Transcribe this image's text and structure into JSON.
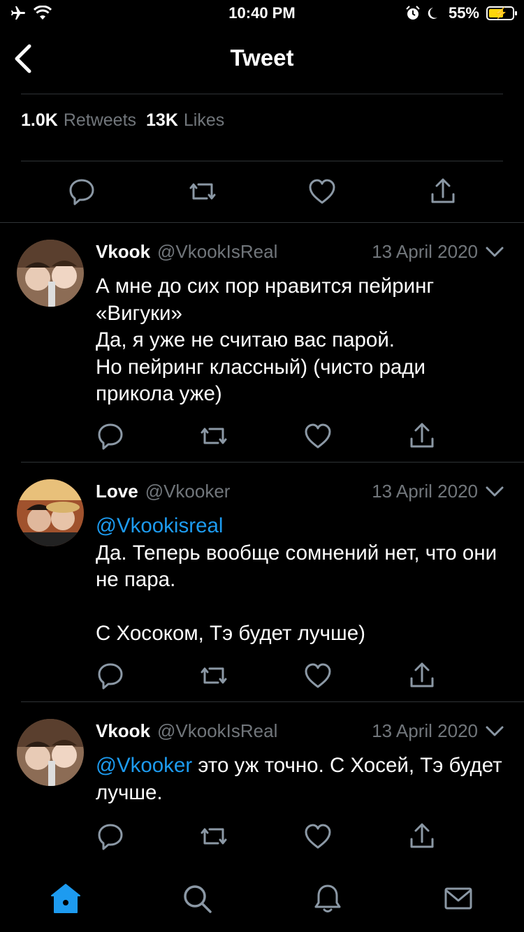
{
  "status_bar": {
    "time": "10:40 PM",
    "battery_percent": "55%"
  },
  "header": {
    "title": "Tweet"
  },
  "stats": {
    "retweets_count": "1.0K",
    "retweets_label": "Retweets",
    "likes_count": "13K",
    "likes_label": "Likes"
  },
  "replies": [
    {
      "name": "Vkook",
      "handle": "@VkookIsReal",
      "date": "13 April 2020",
      "mention": "",
      "text": "А мне до сих пор нравится пейринг «Вигуки»\nДа, я уже не считаю вас парой.\nНо пейринг классный) (чисто ради прикола уже)"
    },
    {
      "name": "Love",
      "handle": "@Vkooker",
      "date": "13 April 2020",
      "mention": "@Vkookisreal",
      "text": "\nДа. Теперь вообще сомнений нет, что они не пара.\n\nС Хосоком, Тэ будет лучше)"
    },
    {
      "name": "Vkook",
      "handle": "@VkookIsReal",
      "date": "13 April 2020",
      "mention": "@Vkooker",
      "text": " это уж точно. С Хосей, Тэ будет лучше."
    }
  ],
  "colors": {
    "accent": "#1d9bf0",
    "muted": "#71767b",
    "divider": "#2f3336",
    "battery": "#ffd60a"
  },
  "icons": {
    "status": [
      "airplane-icon",
      "wifi-icon",
      "alarm-icon",
      "moon-icon",
      "battery-icon"
    ],
    "actions": [
      "reply-icon",
      "retweet-icon",
      "like-icon",
      "share-icon"
    ],
    "tabs": [
      "home-icon",
      "search-icon",
      "notifications-icon",
      "messages-icon"
    ]
  }
}
